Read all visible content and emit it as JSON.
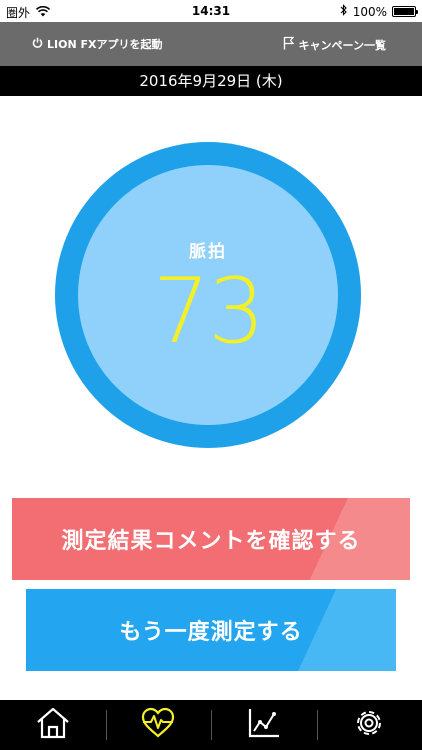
{
  "status_bar": {
    "carrier": "圏外",
    "time": "14:31",
    "battery": "100%"
  },
  "header": {
    "launch_label": "LION FXアプリを起動",
    "campaign_label": "キャンペーン一覧"
  },
  "date": "2016年9月29日 (木)",
  "pulse": {
    "label": "脈拍",
    "value": "73"
  },
  "buttons": {
    "comment_label": "測定結果コメントを確認する",
    "remeasure_label": "もう一度測定する"
  },
  "tabs": [
    {
      "icon": "home-icon",
      "active": false
    },
    {
      "icon": "heart-pulse-icon",
      "active": true
    },
    {
      "icon": "chart-icon",
      "active": false
    },
    {
      "icon": "gear-icon",
      "active": false
    }
  ],
  "colors": {
    "header_bg": "#6b6b6b",
    "circle_outer": "#1ea1e8",
    "circle_inner": "#8fd1fa",
    "pulse_value": "#f3ef29",
    "comment_button": "#f26e72",
    "remeasure_button": "#23a6ef",
    "active_tab": "#f3ef29"
  }
}
